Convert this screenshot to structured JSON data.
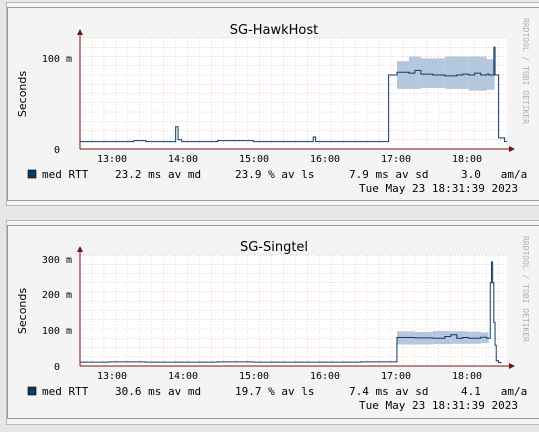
{
  "colors": {
    "page_bg": "#e6e6e6",
    "graph_bg": "#f4f4f4",
    "line": "#0b3a66",
    "band": "#b5c7dc",
    "grid_minor": "#e0a0a0",
    "grid_major": "#c8c8c8",
    "axis": "#7a1010",
    "swatch": "#0b3a66"
  },
  "watermark": "RRDTOOL / TOBI OETIKER",
  "charts": [
    {
      "title": "SG-HawkHost",
      "ylabel": "Seconds",
      "ytick_labels": [
        "100 m",
        "0"
      ],
      "xtick_labels": [
        "13:00",
        "14:00",
        "15:00",
        "16:00",
        "17:00",
        "18:00"
      ],
      "legend_label": "med RTT",
      "stats": {
        "avg": "23.2 ms av md",
        "loss": "23.9 % av ls",
        "sd": "7.9 ms av sd",
        "am": "3.0   am/a"
      },
      "timestamp": "Tue May 23 18:31:39 2023"
    },
    {
      "title": "SG-Singtel",
      "ylabel": "Seconds",
      "ytick_labels": [
        "300 m",
        "200 m",
        "100 m",
        "0"
      ],
      "xtick_labels": [
        "13:00",
        "14:00",
        "15:00",
        "16:00",
        "17:00",
        "18:00"
      ],
      "legend_label": "med RTT",
      "stats": {
        "avg": "30.6 ms av md",
        "loss": "19.7 % av ls",
        "sd": "7.4 ms av sd",
        "am": "4.1   am/a"
      },
      "timestamp": "Tue May 23 18:31:39 2023"
    }
  ],
  "chart_data": [
    {
      "type": "line",
      "title": "SG-HawkHost",
      "ylabel": "Seconds",
      "x_unit": "time of day",
      "xlim": [
        "12:35",
        "18:32"
      ],
      "ylim": [
        0,
        0.12
      ],
      "yticks": [
        0,
        0.1
      ],
      "series": [
        {
          "name": "med RTT",
          "x": [
            "12:35",
            "13:00",
            "13:20",
            "13:30",
            "13:40",
            "13:55",
            "13:57",
            "14:00",
            "14:30",
            "15:00",
            "15:30",
            "15:50",
            "15:52",
            "16:00",
            "16:30",
            "16:50",
            "16:52",
            "16:53",
            "17:00",
            "17:10",
            "17:15",
            "17:20",
            "17:30",
            "17:40",
            "17:50",
            "17:55",
            "18:00",
            "18:05",
            "18:10",
            "18:15",
            "18:17",
            "18:19",
            "18:21",
            "18:22",
            "18:25",
            "18:30",
            "18:32"
          ],
          "y": [
            0.008,
            0.008,
            0.009,
            0.008,
            0.008,
            0.024,
            0.01,
            0.008,
            0.009,
            0.008,
            0.008,
            0.013,
            0.008,
            0.008,
            0.008,
            0.008,
            0.008,
            0.08,
            0.083,
            0.082,
            0.085,
            0.081,
            0.08,
            0.079,
            0.08,
            0.081,
            0.08,
            0.082,
            0.08,
            0.081,
            0.08,
            0.08,
            0.11,
            0.08,
            0.012,
            0.008,
            0.008
          ]
        }
      ],
      "band": {
        "x": [
          "17:00",
          "17:10",
          "17:20",
          "17:40",
          "18:00",
          "18:15"
        ],
        "lo": [
          0.065,
          0.065,
          0.066,
          0.065,
          0.063,
          0.064
        ],
        "hi": [
          0.095,
          0.1,
          0.098,
          0.1,
          0.1,
          0.097
        ]
      }
    },
    {
      "type": "line",
      "title": "SG-Singtel",
      "ylabel": "Seconds",
      "x_unit": "time of day",
      "xlim": [
        "12:35",
        "18:32"
      ],
      "ylim": [
        0,
        0.32
      ],
      "yticks": [
        0,
        0.1,
        0.2,
        0.3
      ],
      "series": [
        {
          "name": "med RTT",
          "x": [
            "12:35",
            "13:00",
            "13:30",
            "14:00",
            "14:30",
            "15:00",
            "15:30",
            "16:00",
            "16:30",
            "16:58",
            "17:00",
            "17:15",
            "17:30",
            "17:40",
            "17:45",
            "17:50",
            "17:55",
            "18:00",
            "18:10",
            "18:15",
            "18:17",
            "18:18",
            "18:19",
            "18:20",
            "18:21",
            "18:22",
            "18:23",
            "18:25",
            "18:27"
          ],
          "y": [
            0.011,
            0.012,
            0.011,
            0.011,
            0.012,
            0.011,
            0.011,
            0.011,
            0.012,
            0.012,
            0.082,
            0.081,
            0.08,
            0.085,
            0.09,
            0.08,
            0.082,
            0.08,
            0.083,
            0.08,
            0.08,
            0.24,
            0.3,
            0.24,
            0.125,
            0.06,
            0.015,
            0.01,
            0.008
          ]
        }
      ],
      "band": {
        "x": [
          "17:00",
          "17:15",
          "17:30",
          "17:45",
          "18:00",
          "18:10"
        ],
        "lo": [
          0.062,
          0.062,
          0.063,
          0.064,
          0.064,
          0.066
        ],
        "hi": [
          0.1,
          0.098,
          0.101,
          0.1,
          0.099,
          0.097
        ]
      }
    }
  ]
}
